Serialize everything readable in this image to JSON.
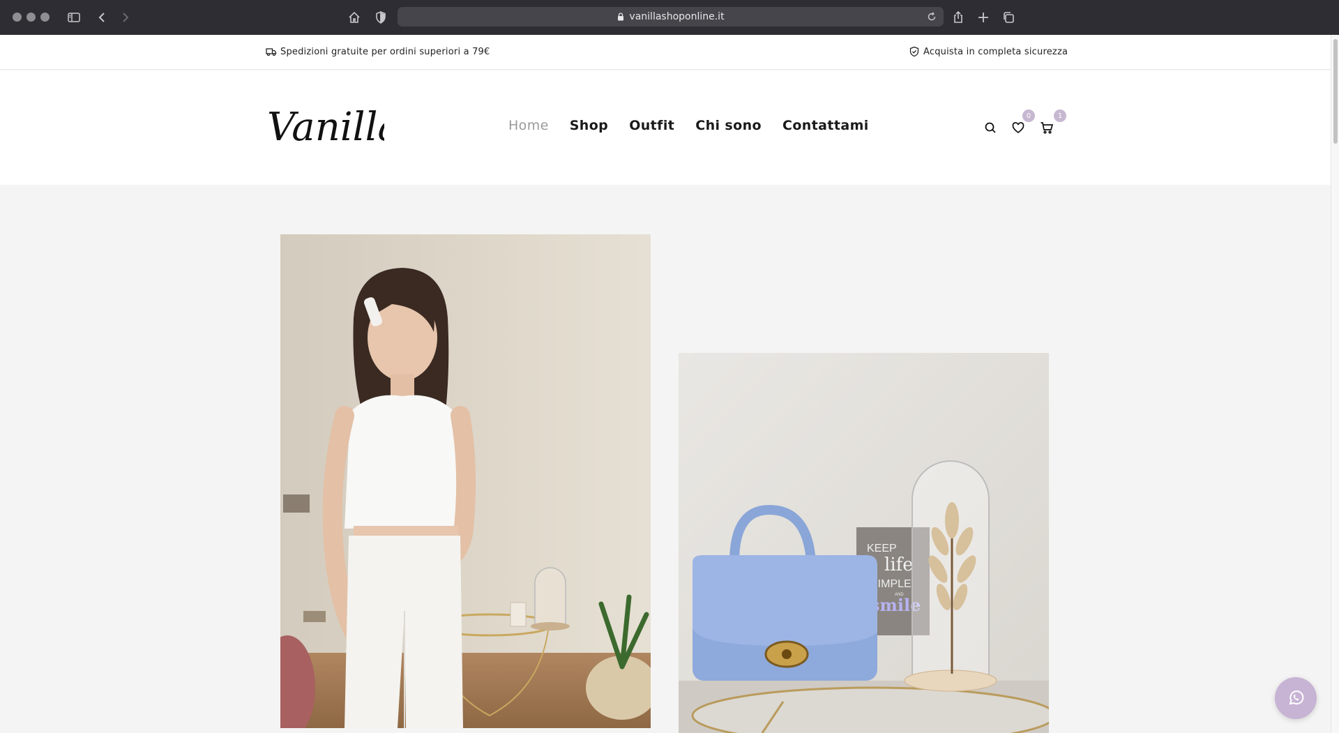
{
  "browser": {
    "url": "vanillashoponline.it",
    "icons": [
      "sidebar-icon",
      "back-icon",
      "forward-icon",
      "home-icon",
      "privacy-shield-icon",
      "lock-icon",
      "reload-icon",
      "share-icon",
      "new-tab-icon",
      "tabs-overview-icon"
    ]
  },
  "info_bar": {
    "shipping_text": "Spedizioni gratuite per ordini superiori a 79€",
    "secure_text": "Acquista in completa sicurezza"
  },
  "header": {
    "logo_text": "Vanilla",
    "nav": [
      {
        "label": "Home",
        "active": true
      },
      {
        "label": "Shop",
        "active": false
      },
      {
        "label": "Outfit",
        "active": false
      },
      {
        "label": "Chi sono",
        "active": false
      },
      {
        "label": "Contattami",
        "active": false
      }
    ],
    "wishlist_count": "0",
    "cart_count": "1"
  },
  "photos": {
    "left_alt": "model-white-outfit-photo",
    "right_alt": "blue-handbag-product-photo",
    "sign_lines": [
      "KEEP",
      "life",
      "SIMPLE",
      "AND",
      "smile"
    ]
  },
  "colors": {
    "accent": "#c7b3d4",
    "badge": "#c7b8d1",
    "page_bg": "#f4f4f4",
    "chrome_bg": "#2d2d33"
  }
}
